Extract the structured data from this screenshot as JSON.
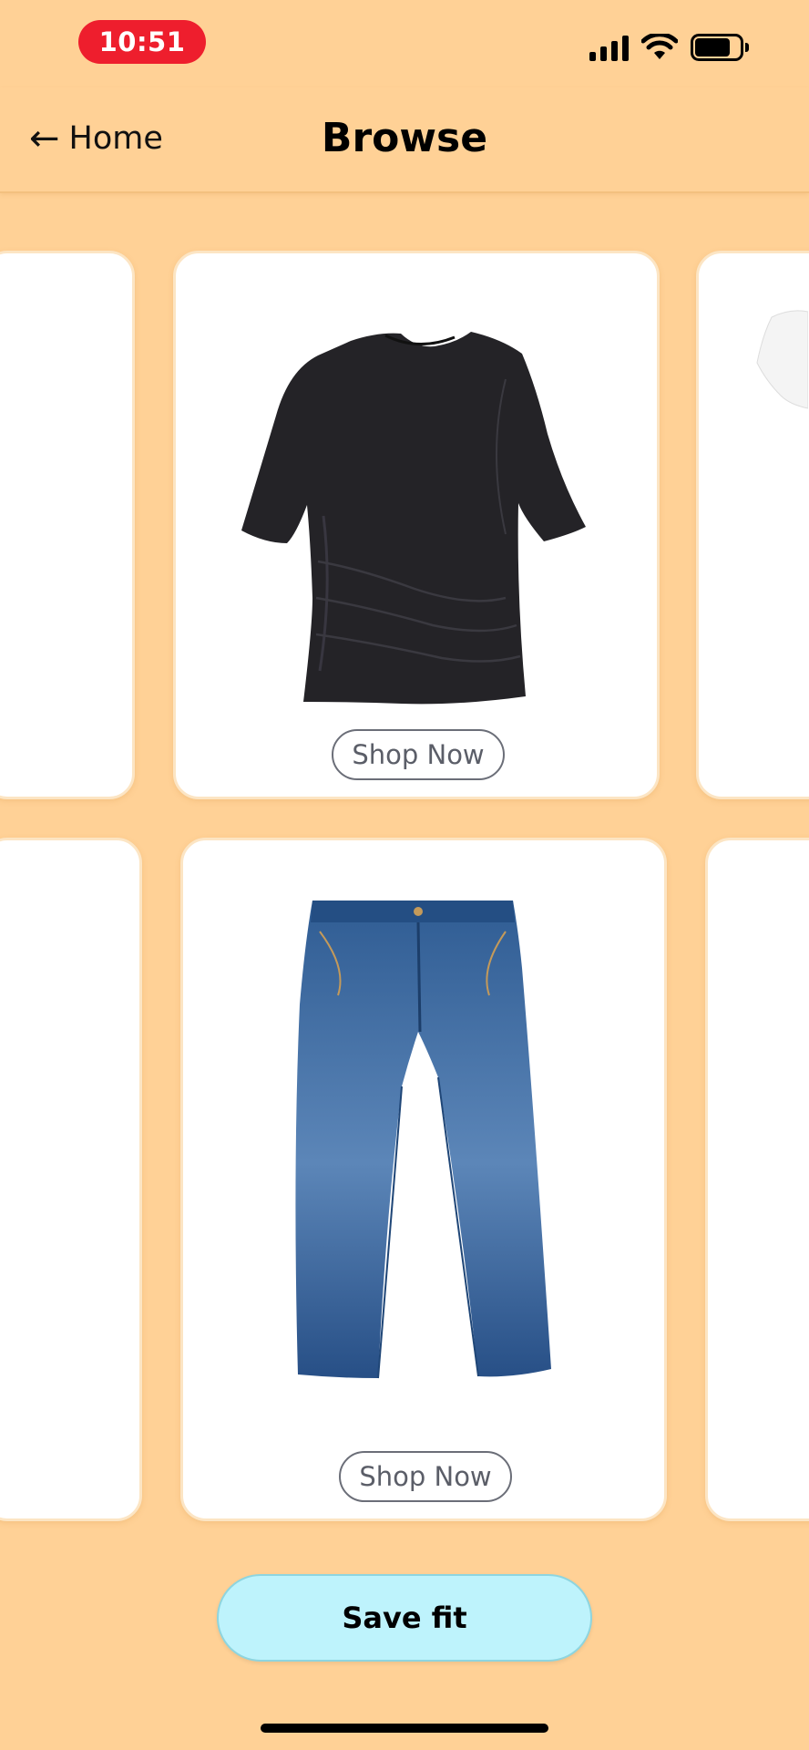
{
  "status_bar": {
    "time": "10:51",
    "icons": [
      "cellular-signal-icon",
      "wifi-icon",
      "battery-icon"
    ]
  },
  "nav": {
    "back_label": "Home",
    "back_icon": "arrow-left-icon",
    "title": "Browse"
  },
  "rows": [
    {
      "name": "tops-row",
      "center_item": {
        "product": "black-ruched-tshirt",
        "button_label": "Shop Now"
      }
    },
    {
      "name": "bottoms-row",
      "center_item": {
        "product": "blue-wide-leg-jeans",
        "button_label": "Shop Now"
      }
    }
  ],
  "save_button_label": "Save fit",
  "colors": {
    "background": "#FFD196",
    "time_pill": "#EE1E2D",
    "save_button": "#BEF3FC",
    "card": "#FFFFFF"
  }
}
